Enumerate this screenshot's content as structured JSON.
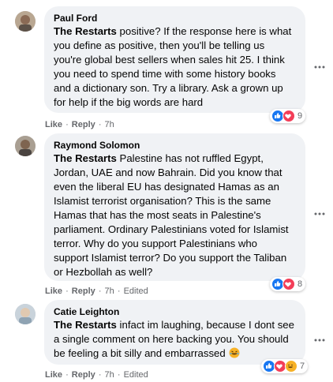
{
  "comments": [
    {
      "author": "Paul Ford",
      "mention": "The Restarts",
      "text": " positive? If the response here is what\nyou define as positive, then you'll be telling us\nyou're global best sellers when sales hit 25. I think\nyou need to spend time with some history books\nand a dictionary son. Try a library. Ask a grown up\nfor help if the big words are hard",
      "like_label": "Like",
      "reply_label": "Reply",
      "time": "7h",
      "edited": "",
      "reaction_count": "9",
      "reactions": [
        "like",
        "love"
      ]
    },
    {
      "author": "Raymond Solomon",
      "mention": "The Restarts",
      "text": " Palestine has not ruffled Egypt,\nJordan, UAE and now Bahrain. Did you know that\neven the liberal EU has designated Hamas as an\nIslamist terrorist organisation? This is the same\nHamas that has the most seats in Palestine's\nparliament. Ordinary Palestinians voted for Islamist\nterror. Why do you support Palestinians who\nsupport Islamist terror? Do you support the Taliban\nor Hezbollah as well?",
      "like_label": "Like",
      "reply_label": "Reply",
      "time": "7h",
      "edited": "Edited",
      "reaction_count": "8",
      "reactions": [
        "like",
        "love"
      ]
    },
    {
      "author": "Catie Leighton",
      "mention": "The Restarts",
      "text": " infact im laughing, because I dont see\na single comment on here backing you. You should\nbe feeling a bit silly and embarrassed",
      "like_label": "Like",
      "reply_label": "Reply",
      "time": "7h",
      "edited": "Edited",
      "reaction_count": "7",
      "reactions": [
        "like",
        "love",
        "haha"
      ]
    }
  ],
  "colors": {
    "bubble": "#f0f2f5",
    "like_blue": "#1877f2",
    "love_red": "#f33e58",
    "haha_yellow": "#f7b125",
    "meta_gray": "#65676b"
  }
}
